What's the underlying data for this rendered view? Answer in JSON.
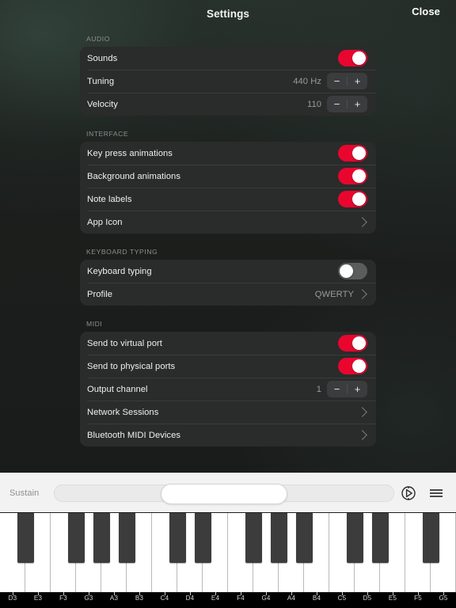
{
  "header": {
    "title": "Settings",
    "close_label": "Close"
  },
  "accent": {
    "on": "#e8062f",
    "off": "#5b5c5c",
    "card": "#2a2b2b"
  },
  "sections": [
    {
      "title": "AUDIO",
      "rows": [
        {
          "label": "Sounds",
          "type": "toggle",
          "state": "on"
        },
        {
          "label": "Tuning",
          "type": "stepper",
          "value": "440 Hz",
          "minus": "−",
          "plus": "+"
        },
        {
          "label": "Velocity",
          "type": "stepper",
          "value": "110",
          "minus": "−",
          "plus": "+"
        }
      ]
    },
    {
      "title": "INTERFACE",
      "rows": [
        {
          "label": "Key press animations",
          "type": "toggle",
          "state": "on"
        },
        {
          "label": "Background animations",
          "type": "toggle",
          "state": "on"
        },
        {
          "label": "Note labels",
          "type": "toggle",
          "state": "on"
        },
        {
          "label": "App Icon",
          "type": "disclosure",
          "value": ""
        }
      ]
    },
    {
      "title": "KEYBOARD TYPING",
      "rows": [
        {
          "label": "Keyboard typing",
          "type": "toggle",
          "state": "off"
        },
        {
          "label": "Profile",
          "type": "disclosure",
          "value": "QWERTY"
        }
      ]
    },
    {
      "title": "MIDI",
      "rows": [
        {
          "label": "Send to virtual port",
          "type": "toggle",
          "state": "on"
        },
        {
          "label": "Send to physical ports",
          "type": "toggle",
          "state": "on"
        },
        {
          "label": "Output channel",
          "type": "stepper",
          "value": "1",
          "minus": "−",
          "plus": "+"
        },
        {
          "label": "Network Sessions",
          "type": "disclosure",
          "value": ""
        },
        {
          "label": "Bluetooth MIDI Devices",
          "type": "disclosure",
          "value": ""
        }
      ]
    }
  ],
  "bottombar": {
    "sustain_label": "Sustain",
    "sustain_value": 50,
    "icons": [
      {
        "name": "metronome-dial-icon"
      },
      {
        "name": "hamburger-menu-icon"
      }
    ]
  },
  "piano": {
    "white_keys": [
      "D3",
      "E3",
      "F3",
      "G3",
      "A3",
      "B3",
      "C4",
      "D4",
      "E4",
      "F4",
      "G4",
      "A4",
      "B4",
      "C5",
      "D5",
      "E5",
      "F5",
      "G5"
    ],
    "black_key_after_index": [
      0,
      2,
      3,
      4,
      6,
      7,
      9,
      10,
      11,
      13,
      14,
      16
    ]
  }
}
